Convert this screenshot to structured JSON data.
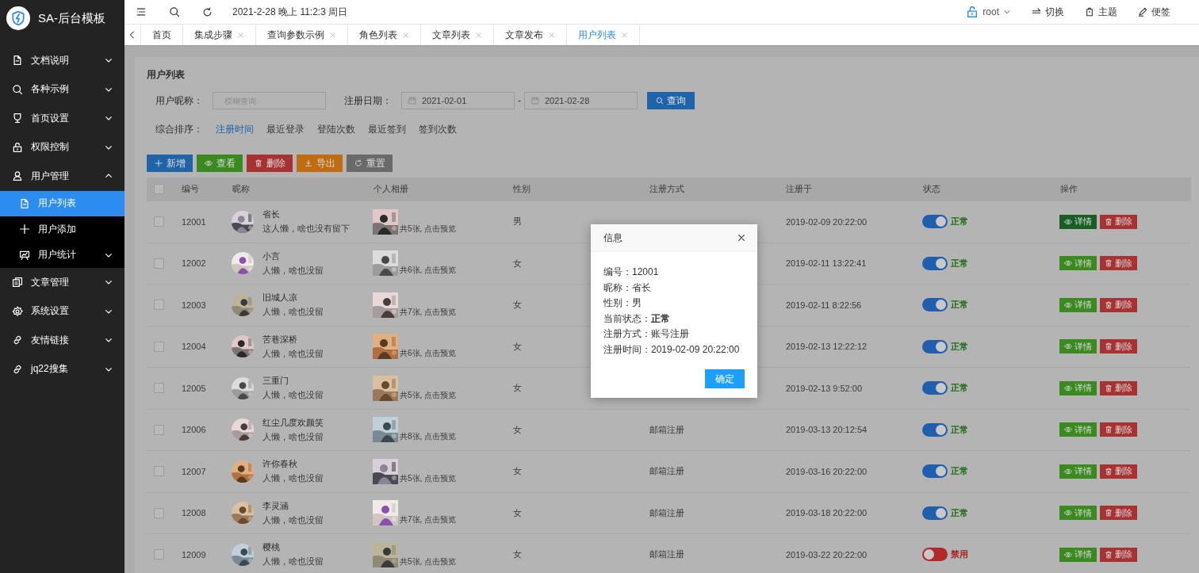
{
  "sidebar": {
    "title": "SA-后台模板",
    "items": [
      {
        "label": "文档说明",
        "expanded": false
      },
      {
        "label": "各种示例",
        "expanded": false
      },
      {
        "label": "首页设置",
        "expanded": false
      },
      {
        "label": "权限控制",
        "expanded": false
      },
      {
        "label": "用户管理",
        "expanded": true,
        "children": [
          {
            "label": "用户列表",
            "selected": true
          },
          {
            "label": "用户添加",
            "selected": false
          },
          {
            "label": "用户统计",
            "selected": false,
            "expanded": false
          }
        ]
      },
      {
        "label": "文章管理",
        "expanded": false
      },
      {
        "label": "系统设置",
        "expanded": false
      },
      {
        "label": "友情链接",
        "expanded": false
      },
      {
        "label": "jq22搜集",
        "expanded": false
      }
    ]
  },
  "header": {
    "date_time": "2021-2-28 晚上 11:2:3 周日",
    "user": "root",
    "actions": [
      "切换",
      "主题",
      "便签"
    ]
  },
  "tabs": [
    {
      "label": "首页",
      "closable": false,
      "selected": false
    },
    {
      "label": "集成步骤",
      "closable": true,
      "selected": false
    },
    {
      "label": "查询参数示例",
      "closable": true,
      "selected": false
    },
    {
      "label": "角色列表",
      "closable": true,
      "selected": false
    },
    {
      "label": "文章列表",
      "closable": true,
      "selected": false
    },
    {
      "label": "文章发布",
      "closable": true,
      "selected": false
    },
    {
      "label": "用户列表",
      "closable": true,
      "selected": true
    }
  ],
  "page": {
    "title": "用户列表",
    "search": {
      "label": "用户昵称：",
      "placeholder": "模糊查询"
    },
    "date_range": {
      "label": "注册日期：",
      "start": "2021-02-01",
      "separator": "-",
      "end": "2021-02-28"
    },
    "query_button": "查询",
    "sort": {
      "label": "综合排序：",
      "options": [
        {
          "label": "注册时间",
          "selected": true
        },
        {
          "label": "最近登录",
          "selected": false
        },
        {
          "label": "登陆次数",
          "selected": false
        },
        {
          "label": "最近签到",
          "selected": false
        },
        {
          "label": "签到次数",
          "selected": false
        }
      ]
    },
    "toolbar": [
      {
        "label": "新增",
        "kind": "add"
      },
      {
        "label": "查看",
        "kind": "view"
      },
      {
        "label": "删除",
        "kind": "delete"
      },
      {
        "label": "导出",
        "kind": "export"
      },
      {
        "label": "重置",
        "kind": "reset"
      }
    ]
  },
  "table": {
    "select_all": {
      "checked": false
    },
    "columns": [
      "编号",
      "昵称",
      "个人相册",
      "性别",
      "注册方式",
      "注册于",
      "状态",
      "操作"
    ],
    "rows": [
      {
        "checked": false,
        "id": "12001",
        "nickname": "省长",
        "bio": "这人懒，啥也没有留下",
        "album": "共5张, 点击预览",
        "gender": "男",
        "registered": "2019-02-09 20:22:00",
        "status": {
          "on": true,
          "label": "正常"
        },
        "actions": [
          "详情",
          "删除"
        ],
        "detail_pressed": true
      },
      {
        "checked": false,
        "id": "12002",
        "nickname": "小言",
        "bio": "人懒，啥也没留",
        "album": "共6张, 点击预览",
        "gender": "女",
        "registered": "2019-02-11 13:22:41",
        "status": {
          "on": true,
          "label": "正常"
        },
        "actions": [
          "详情",
          "删除"
        ],
        "detail_pressed": false
      },
      {
        "checked": false,
        "id": "12003",
        "nickname": "旧城人凉",
        "bio": "人懒，啥也没留",
        "album": "共7张, 点击预览",
        "gender": "女",
        "registered": "2019-02-11 8:22:56",
        "status": {
          "on": true,
          "label": "正常"
        },
        "actions": [
          "详情",
          "删除"
        ],
        "detail_pressed": false
      },
      {
        "checked": false,
        "id": "12004",
        "nickname": "苦巷深桥",
        "bio": "人懒，啥也没留",
        "album": "共6张, 点击预览",
        "gender": "女",
        "registered": "2019-02-13 12:22:12",
        "status": {
          "on": true,
          "label": "正常"
        },
        "actions": [
          "详情",
          "删除"
        ],
        "detail_pressed": false
      },
      {
        "checked": false,
        "id": "12005",
        "nickname": "三重门",
        "bio": "人懒，啥也没留",
        "album": "共5张, 点击预览",
        "gender": "女",
        "registered": "2019-02-13 9:52:00",
        "status": {
          "on": true,
          "label": "正常"
        },
        "actions": [
          "详情",
          "删除"
        ],
        "detail_pressed": false
      },
      {
        "checked": false,
        "id": "12006",
        "nickname": "红尘几度欢颜笑",
        "bio": "人懒，啥也没留",
        "album": "共8张, 点击预览",
        "gender": "女",
        "method": "邮箱注册",
        "registered": "2019-03-13 20:12:54",
        "status": {
          "on": true,
          "label": "正常"
        },
        "actions": [
          "详情",
          "删除"
        ],
        "detail_pressed": false
      },
      {
        "checked": false,
        "id": "12007",
        "nickname": "许你春秋",
        "bio": "人懒，啥也没留",
        "album": "共5张, 点击预览",
        "gender": "女",
        "method": "邮箱注册",
        "registered": "2019-03-16 20:22:00",
        "status": {
          "on": true,
          "label": "正常"
        },
        "actions": [
          "详情",
          "删除"
        ],
        "detail_pressed": false
      },
      {
        "checked": false,
        "id": "12008",
        "nickname": "李灵涵",
        "bio": "人懒，啥也没留",
        "album": "共7张, 点击预览",
        "gender": "女",
        "method": "邮箱注册",
        "registered": "2019-03-18 20:22:00",
        "status": {
          "on": true,
          "label": "正常"
        },
        "actions": [
          "详情",
          "删除"
        ],
        "detail_pressed": false
      },
      {
        "checked": false,
        "id": "12009",
        "nickname": "樱桃",
        "bio": "人懒，啥也没留",
        "album": "共5张, 点击预览",
        "gender": "女",
        "method": "邮箱注册",
        "registered": "2019-03-22 20:22:00",
        "status": {
          "on": false,
          "label": "禁用"
        },
        "actions": [
          "详情",
          "删除"
        ],
        "detail_pressed": false
      }
    ]
  },
  "dialog": {
    "title": "信息",
    "lines": [
      "编号：12001",
      "昵称：省长",
      "性别：男",
      "当前状态：**正常**",
      "注册方式：账号注册",
      "注册时间：2019-02-09 20:22:00"
    ],
    "button": "确定"
  }
}
